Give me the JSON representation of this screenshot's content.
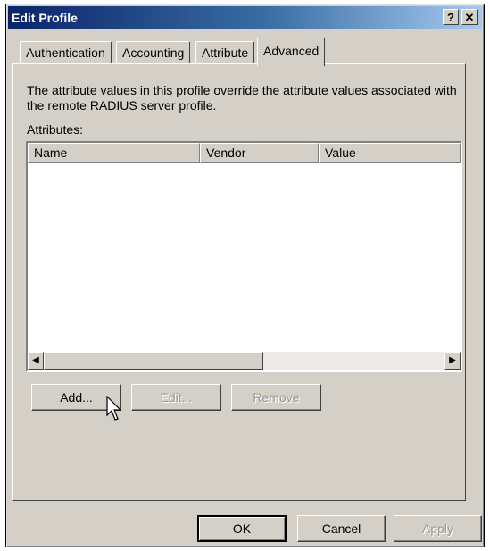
{
  "window": {
    "title": "Edit Profile",
    "help_label": "?",
    "close_label": "✕"
  },
  "tabs": [
    {
      "label": "Authentication",
      "active": false
    },
    {
      "label": "Accounting",
      "active": false
    },
    {
      "label": "Attribute",
      "active": false
    },
    {
      "label": "Advanced",
      "active": true
    }
  ],
  "advanced": {
    "description": "The attribute values in this profile override the attribute values associated with the remote RADIUS server profile.",
    "attributes_label": "Attributes:",
    "columns": [
      "Name",
      "Vendor",
      "Value"
    ],
    "rows": [],
    "buttons": {
      "add": "Add...",
      "edit": "Edit...",
      "remove": "Remove"
    }
  },
  "footer": {
    "ok": "OK",
    "cancel": "Cancel",
    "apply": "Apply"
  },
  "icons": {
    "scroll_left": "scroll-left-arrow-icon",
    "scroll_right": "scroll-right-arrow-icon",
    "cursor": "mouse-pointer-icon"
  }
}
